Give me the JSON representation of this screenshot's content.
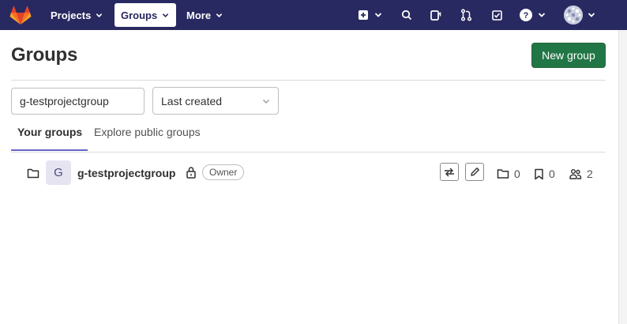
{
  "navbar": {
    "projects_label": "Projects",
    "groups_label": "Groups",
    "more_label": "More",
    "colors": {
      "background": "#292961",
      "active_bg": "#ffffff"
    }
  },
  "header": {
    "title": "Groups",
    "new_group_label": "New group",
    "new_group_color": "#217645"
  },
  "filters": {
    "search_value": "g-testprojectgroup",
    "sort_value": "Last created"
  },
  "tabs": [
    {
      "label": "Your groups",
      "active": true
    },
    {
      "label": "Explore public groups",
      "active": false
    }
  ],
  "groups": [
    {
      "avatar_letter": "G",
      "name": "g-testprojectgroup",
      "visibility_icon": "lock-icon",
      "role": "Owner",
      "subgroups": "0",
      "projects": "0",
      "members": "2"
    }
  ],
  "icons": {
    "nav": [
      "plus-square-icon",
      "search-icon",
      "issues-icon",
      "merge-request-icon",
      "todo-icon",
      "help-icon"
    ],
    "row": [
      "folder-icon",
      "leave-icon",
      "pencil-icon",
      "subgroup-icon",
      "bookmark-icon",
      "users-icon"
    ]
  }
}
